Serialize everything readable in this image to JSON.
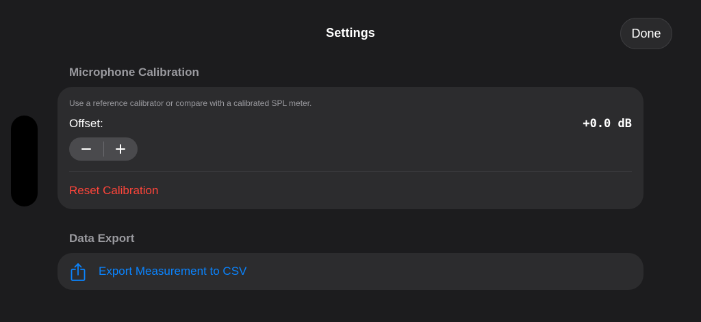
{
  "nav": {
    "title": "Settings",
    "done_label": "Done"
  },
  "calibration": {
    "header": "Microphone Calibration",
    "hint": "Use a reference calibrator or compare with a calibrated SPL meter.",
    "offset_label": "Offset:",
    "offset_value": "+0.0 dB",
    "reset_label": "Reset Calibration",
    "stepper_icons": [
      "minus-icon",
      "plus-icon"
    ]
  },
  "export": {
    "header": "Data Export",
    "button_label": "Export Measurement to CSV",
    "icon": "share-icon"
  },
  "colors": {
    "background": "#1c1c1e",
    "card": "#2c2c2e",
    "destructive": "#ff453a",
    "accent": "#0a84ff",
    "secondary_text": "#9a9a9f"
  }
}
